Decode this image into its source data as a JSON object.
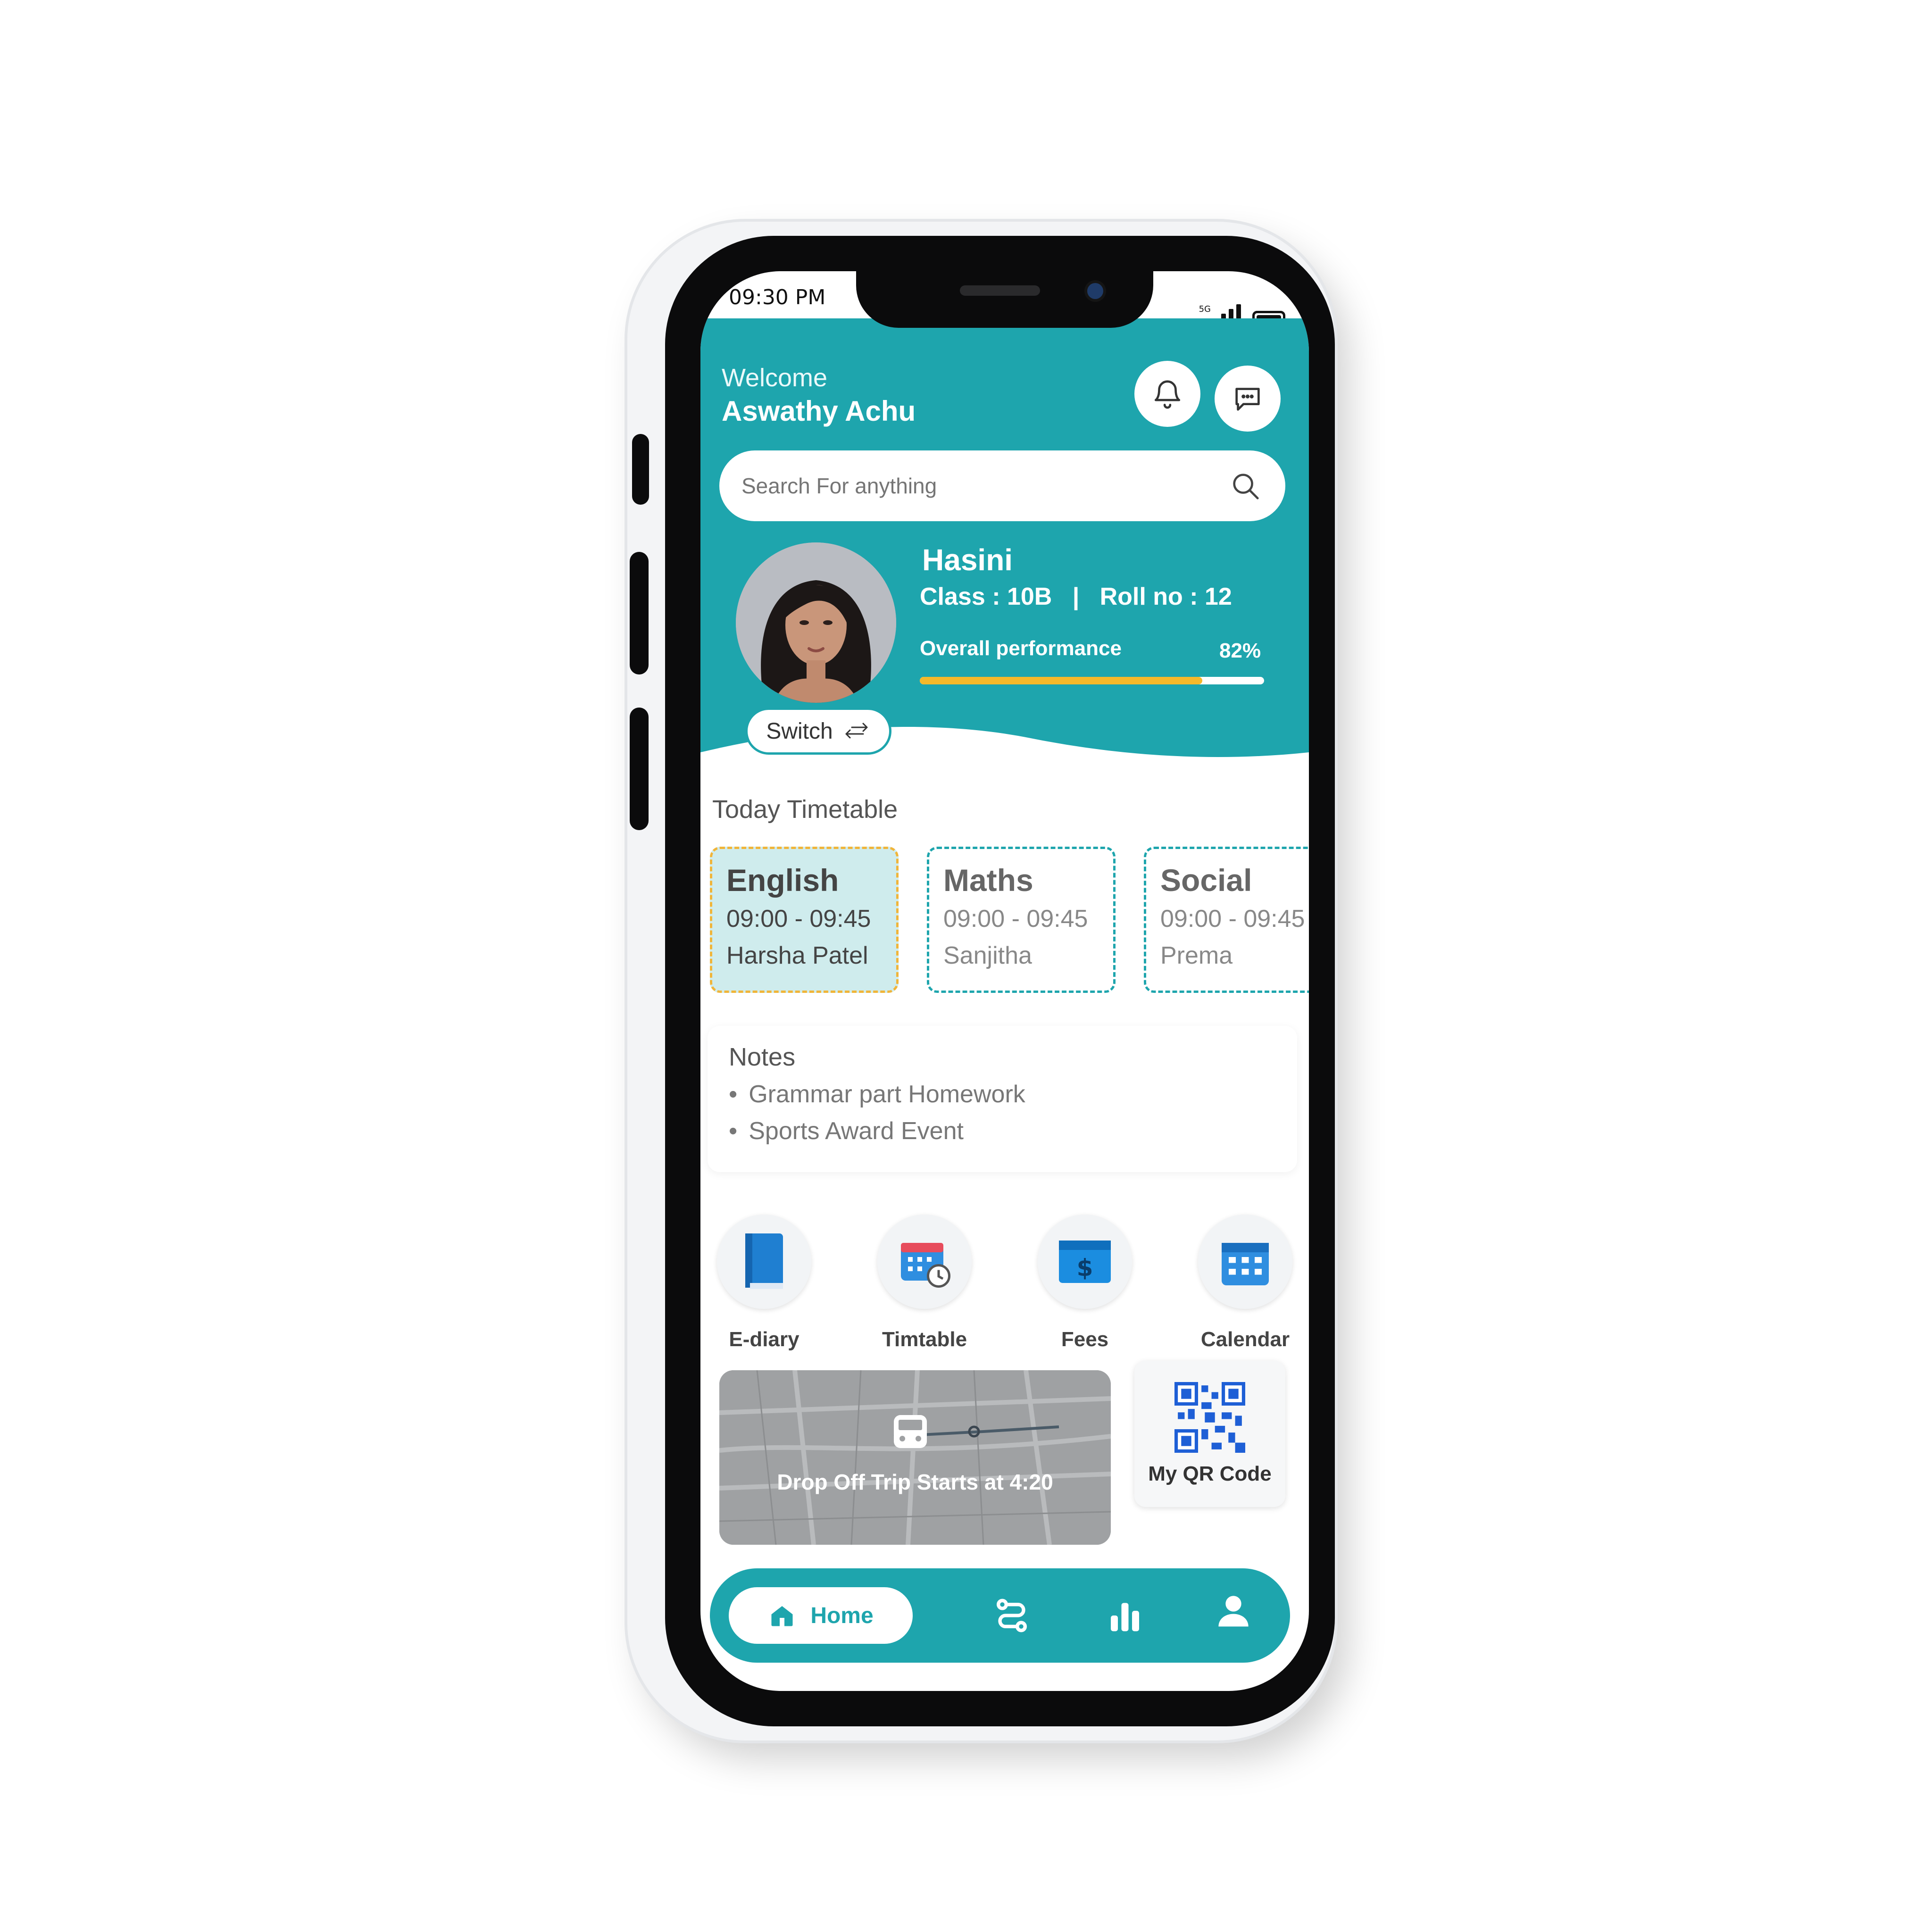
{
  "status_bar": {
    "time": "09:30 PM",
    "network": "5G"
  },
  "header": {
    "welcome": "Welcome",
    "username": "Aswathy Achu"
  },
  "search": {
    "placeholder": "Search For anything"
  },
  "student": {
    "name": "Hasini",
    "class_roll": "Class : 10B   |   Roll no : 12",
    "performance_label": "Overall performance",
    "performance_value": "82%",
    "performance_fraction": 0.82,
    "switch_label": "Switch"
  },
  "timetable": {
    "title": "Today Timetable",
    "items": [
      {
        "subject": "English",
        "time": "09:00 - 09:45",
        "teacher": "Harsha Patel"
      },
      {
        "subject": "Maths",
        "time": "09:00 - 09:45",
        "teacher": "Sanjitha"
      },
      {
        "subject": "Social",
        "time": "09:00 - 09:45",
        "teacher": "Prema"
      }
    ]
  },
  "notes": {
    "title": "Notes",
    "items": [
      "Grammar part Homework",
      "Sports Award Event"
    ]
  },
  "quick_links": [
    {
      "label": "E-diary",
      "icon": "book-icon"
    },
    {
      "label": "Timtable",
      "icon": "timetable-icon"
    },
    {
      "label": "Fees",
      "icon": "fees-icon"
    },
    {
      "label": "Calendar",
      "icon": "calendar-icon"
    }
  ],
  "map": {
    "text": "Drop Off Trip Starts at 4:20"
  },
  "qr": {
    "label": "My QR Code"
  },
  "bottom_nav": {
    "home_label": "Home"
  },
  "colors": {
    "primary": "#1ea5ad",
    "accent": "#f5b92a",
    "active_card_bg": "#cfeced"
  }
}
